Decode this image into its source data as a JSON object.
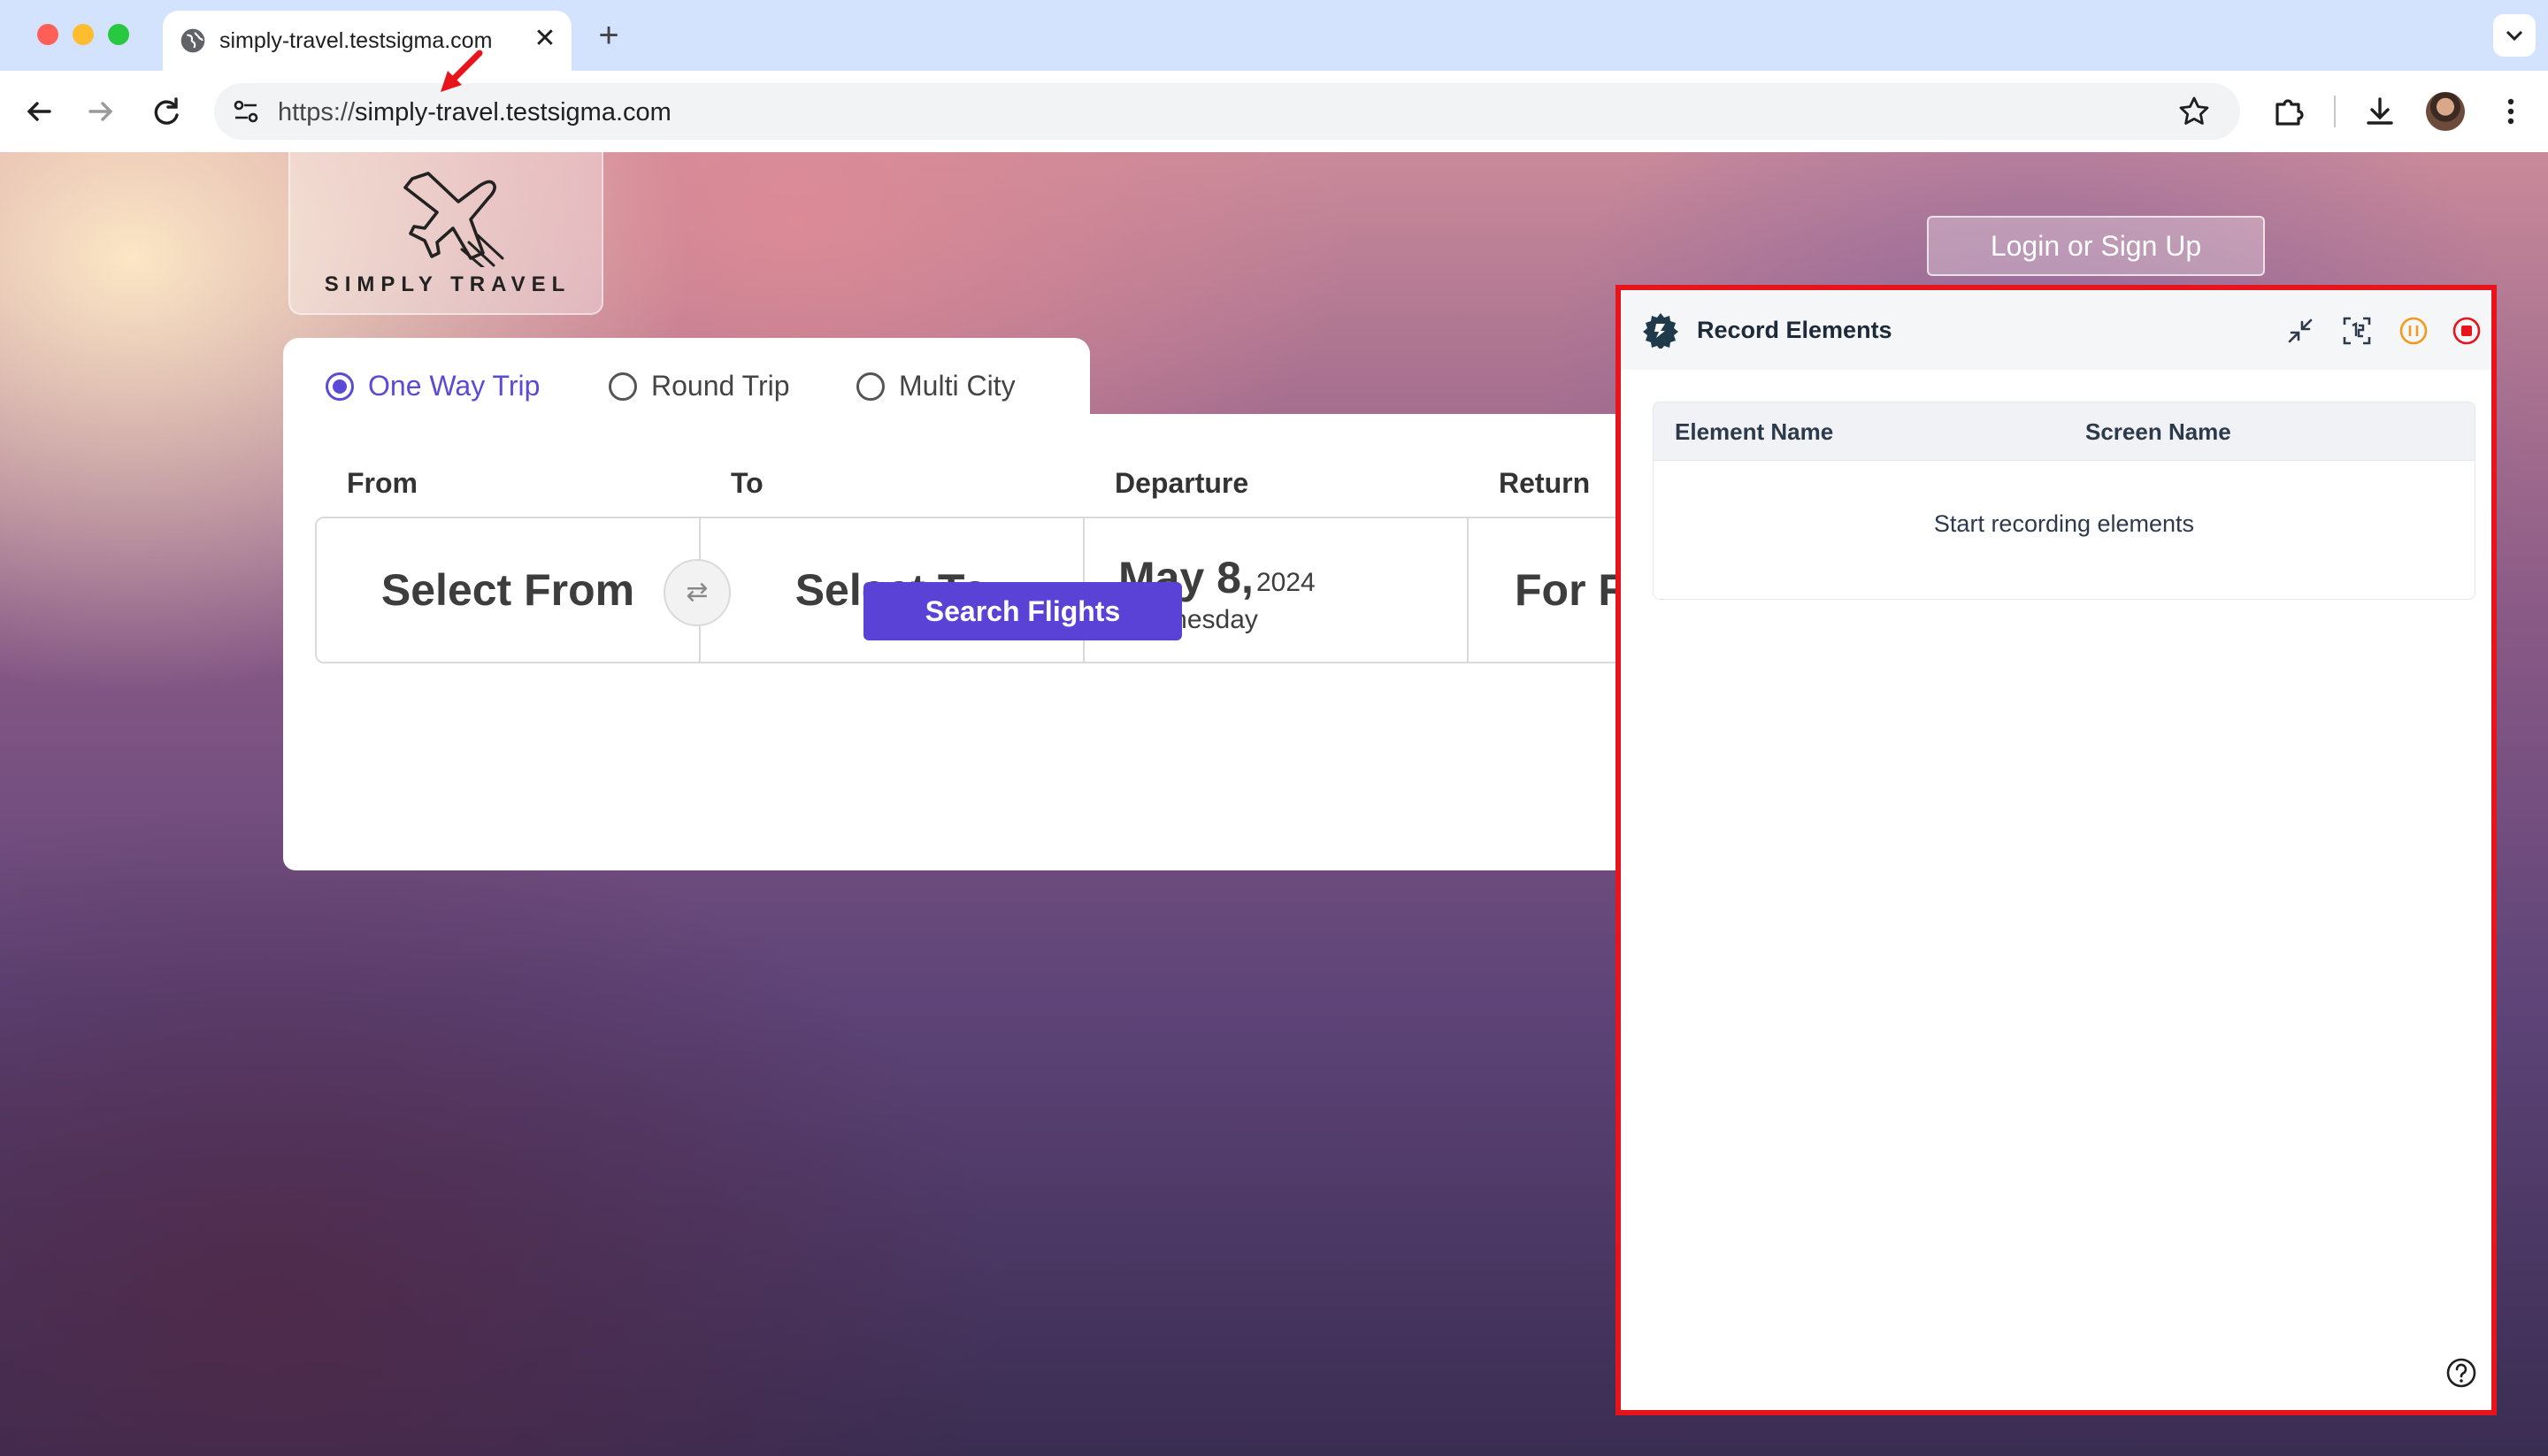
{
  "browser": {
    "tab_title": "simply-travel.testsigma.com",
    "tab_close": "✕",
    "new_tab": "+",
    "url_scheme": "https://",
    "url_host": "simply-travel.testsigma.com"
  },
  "site": {
    "logo_text": "SIMPLY TRAVEL",
    "login_label": "Login or Sign Up",
    "trip_types": [
      {
        "label": "One Way Trip",
        "selected": true
      },
      {
        "label": "Round Trip",
        "selected": false
      },
      {
        "label": "Multi City",
        "selected": false
      }
    ],
    "fields": {
      "from_label": "From",
      "to_label": "To",
      "departure_label": "Departure",
      "return_label": "Return",
      "from_value": "Select From",
      "to_value": "Select To",
      "departure_date": "May 8,",
      "departure_year": "2024",
      "departure_day": "Wednesday",
      "return_value": "For Re",
      "swap_glyph": "⇄"
    },
    "search_label": "Search Flights",
    "accent_color": "#5a42d6"
  },
  "panel": {
    "title": "Record Elements",
    "columns": [
      "Element Name",
      "Screen Name"
    ],
    "empty_message": "Start recording elements",
    "border_color": "#e8141b"
  }
}
